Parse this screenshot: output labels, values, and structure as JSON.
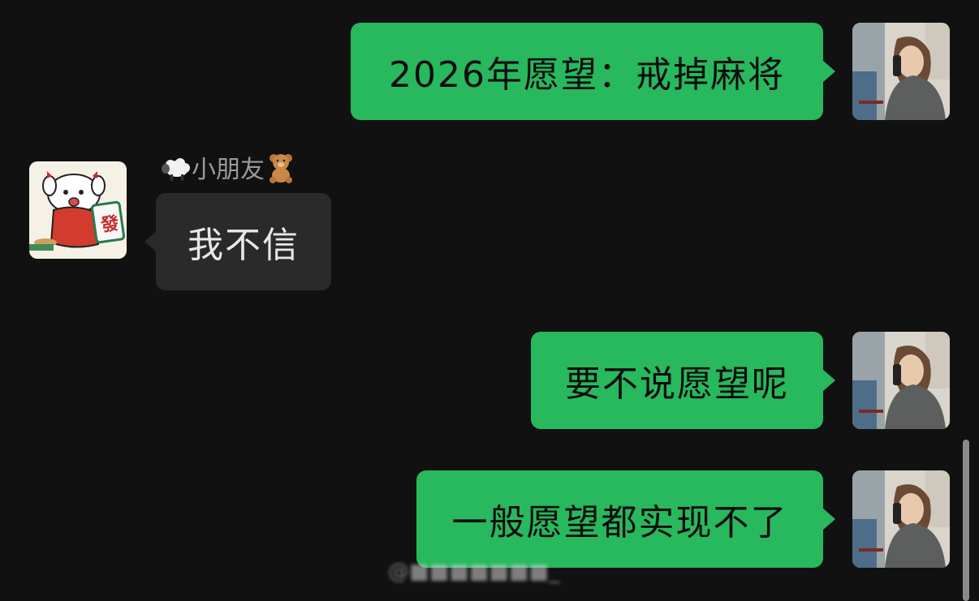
{
  "chat": {
    "messages": [
      {
        "sender": "me",
        "text": "2026年愿望：戒掉麻将"
      },
      {
        "sender": "other",
        "name": "小朋友",
        "text": "我不信"
      },
      {
        "sender": "me",
        "text": "要不说愿望呢"
      },
      {
        "sender": "me",
        "text": "一般愿望都实现不了"
      }
    ],
    "other_name": "小朋友",
    "other_name_prefix_emoji": "sheep-emoji",
    "other_name_suffix_emoji": "teddy-bear-emoji"
  },
  "avatars": {
    "me": "photo-avatar-girl-on-phone",
    "other": "cartoon-dog-mahjong-avatar"
  },
  "colors": {
    "background": "#111111",
    "my_bubble": "#28b85d",
    "other_bubble": "#2a2a2a",
    "name_text": "#9a9a9a"
  },
  "watermark": "@■■■■■■■_"
}
